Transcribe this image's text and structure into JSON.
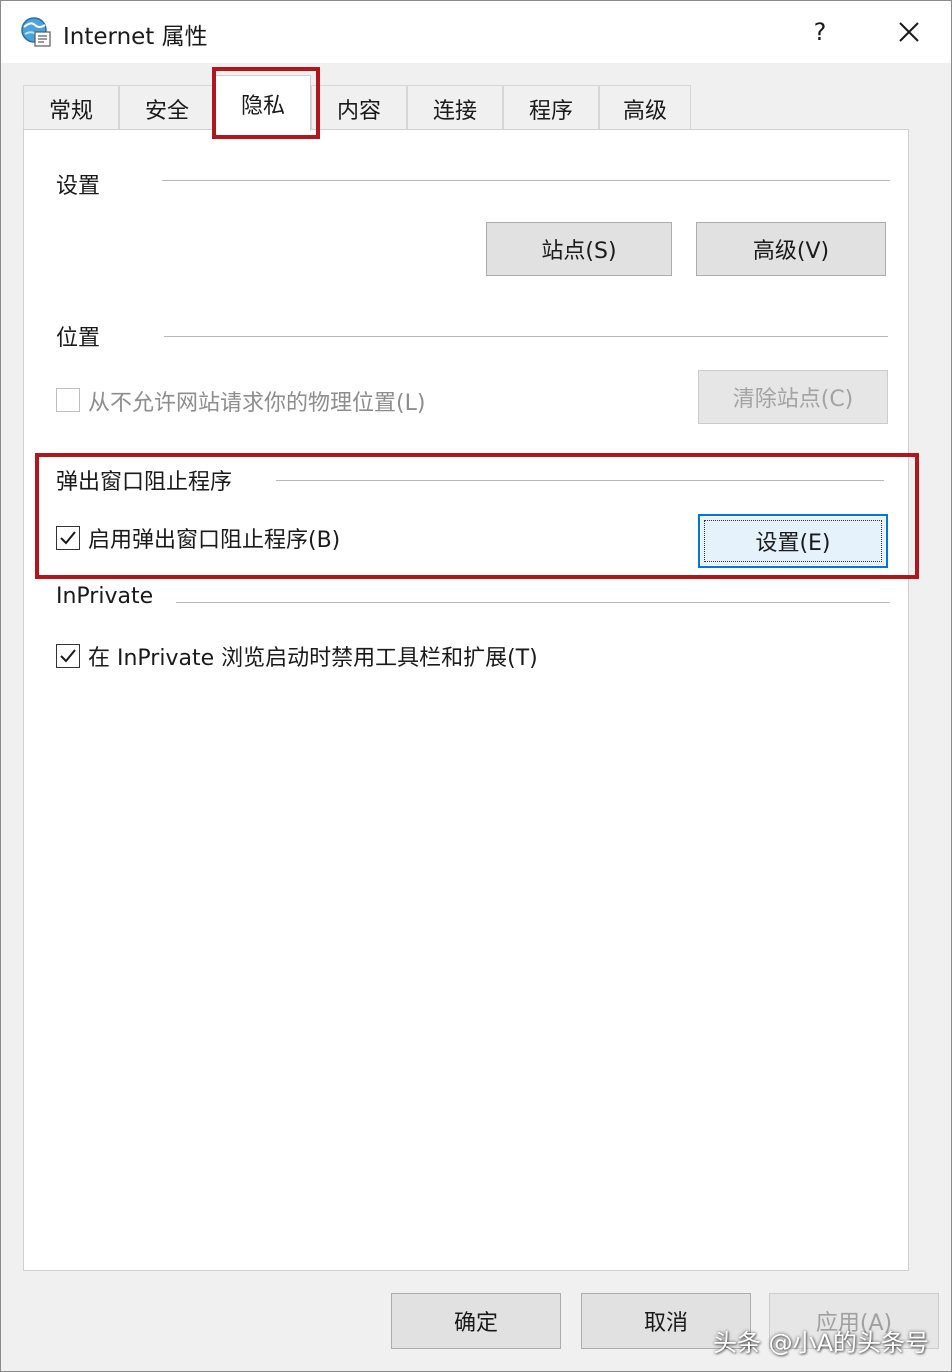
{
  "window": {
    "title": "Internet 属性",
    "help_label": "?"
  },
  "tabs": [
    {
      "label": "常规"
    },
    {
      "label": "安全"
    },
    {
      "label": "隐私",
      "active": true
    },
    {
      "label": "内容"
    },
    {
      "label": "连接"
    },
    {
      "label": "程序"
    },
    {
      "label": "高级"
    }
  ],
  "settings_section": {
    "title": "设置",
    "sites_button": "站点(S)",
    "advanced_button": "高级(V)"
  },
  "location_section": {
    "title": "位置",
    "never_allow_label": "从不允许网站请求你的物理位置(L)",
    "never_allow_checked": false,
    "clear_sites_button": "清除站点(C)"
  },
  "popup_section": {
    "title": "弹出窗口阻止程序",
    "enable_label": "启用弹出窗口阻止程序(B)",
    "enable_checked": true,
    "settings_button": "设置(E)"
  },
  "inprivate_section": {
    "title": "InPrivate",
    "disable_toolbars_label": "在 InPrivate 浏览启动时禁用工具栏和扩展(T)",
    "disable_toolbars_checked": true
  },
  "footer": {
    "ok_button": "确定",
    "cancel_button": "取消",
    "apply_button": "应用(A)"
  },
  "watermark": "头条 @小A的头条号",
  "colors": {
    "highlight_red": "#b0161b",
    "focus_blue": "#0078d7",
    "dialog_bg": "#f0f0f0"
  }
}
